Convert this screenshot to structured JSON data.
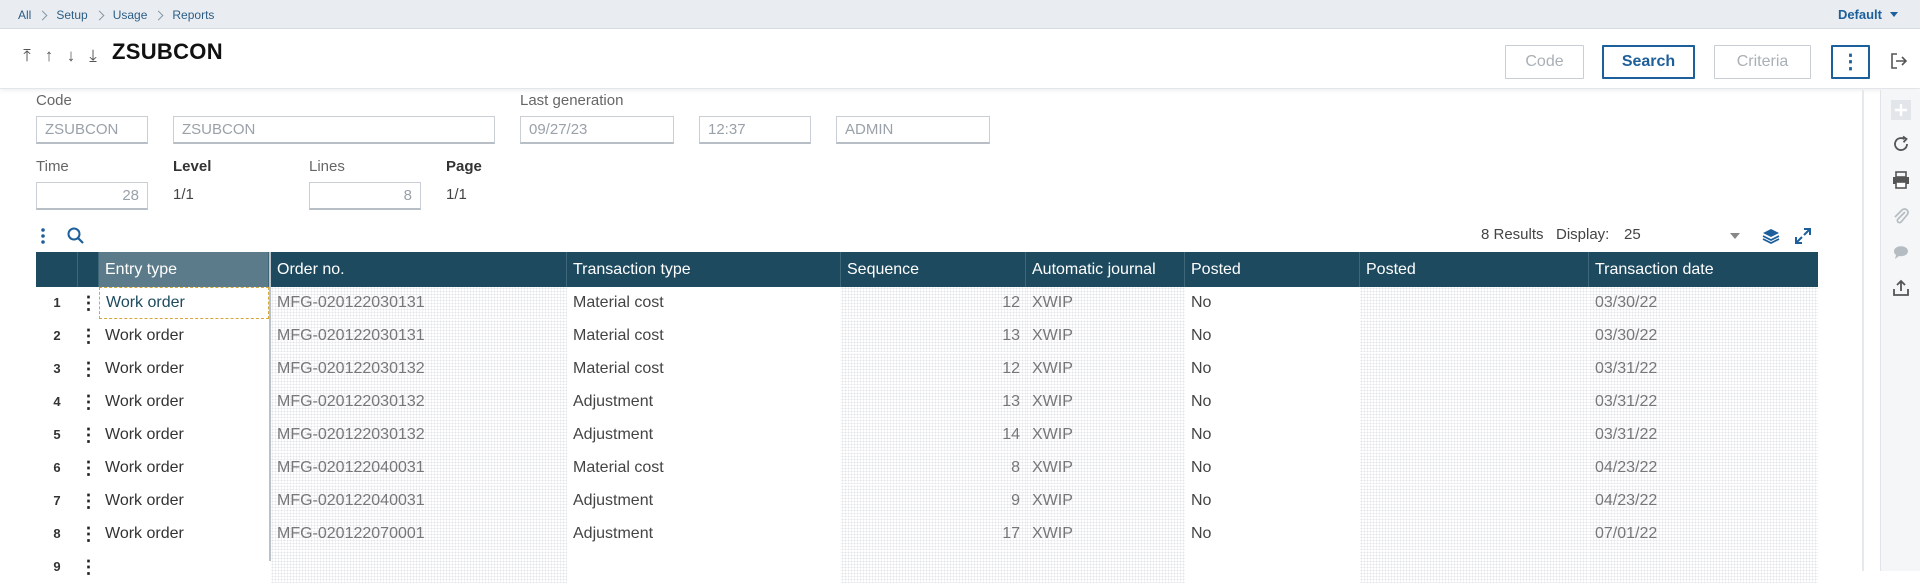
{
  "breadcrumb": [
    "All",
    "Setup",
    "Usage",
    "Reports"
  ],
  "default_menu": "Default",
  "header": {
    "title": "ZSUBCON",
    "nav_icons": [
      "first-record-icon",
      "previous-record-icon",
      "next-record-icon",
      "last-record-icon"
    ],
    "buttons": {
      "code": "Code",
      "search": "Search",
      "criteria": "Criteria",
      "more": "⋮"
    }
  },
  "form": {
    "code_label": "Code",
    "code_value": "ZSUBCON",
    "description_value": "ZSUBCON",
    "last_generation_label": "Last generation",
    "last_generation_date": "09/27/23",
    "last_generation_time": "12:37",
    "last_generation_user": "ADMIN",
    "time_label": "Time",
    "time_value": "28",
    "level_label": "Level",
    "level_value": "1/1",
    "lines_label": "Lines",
    "lines_value": "8",
    "page_label": "Page",
    "page_value": "1/1"
  },
  "grid": {
    "results_text": "8 Results",
    "display_label": "Display:",
    "display_value": "25",
    "columns": [
      "Entry type",
      "Order no.",
      "Transaction type",
      "Sequence",
      "Automatic journal",
      "Posted",
      "Posted",
      "Transaction date"
    ],
    "rows": [
      {
        "num": "1",
        "entry": "Work order",
        "order": "MFG-020122030131",
        "ttype": "Material cost",
        "seq": "12",
        "journal": "XWIP",
        "posted": "No",
        "posted2": "",
        "date": "03/30/22"
      },
      {
        "num": "2",
        "entry": "Work order",
        "order": "MFG-020122030131",
        "ttype": "Material cost",
        "seq": "13",
        "journal": "XWIP",
        "posted": "No",
        "posted2": "",
        "date": "03/30/22"
      },
      {
        "num": "3",
        "entry": "Work order",
        "order": "MFG-020122030132",
        "ttype": "Material cost",
        "seq": "12",
        "journal": "XWIP",
        "posted": "No",
        "posted2": "",
        "date": "03/31/22"
      },
      {
        "num": "4",
        "entry": "Work order",
        "order": "MFG-020122030132",
        "ttype": "Adjustment",
        "seq": "13",
        "journal": "XWIP",
        "posted": "No",
        "posted2": "",
        "date": "03/31/22"
      },
      {
        "num": "5",
        "entry": "Work order",
        "order": "MFG-020122030132",
        "ttype": "Adjustment",
        "seq": "14",
        "journal": "XWIP",
        "posted": "No",
        "posted2": "",
        "date": "03/31/22"
      },
      {
        "num": "6",
        "entry": "Work order",
        "order": "MFG-020122040031",
        "ttype": "Material cost",
        "seq": "8",
        "journal": "XWIP",
        "posted": "No",
        "posted2": "",
        "date": "04/23/22"
      },
      {
        "num": "7",
        "entry": "Work order",
        "order": "MFG-020122040031",
        "ttype": "Adjustment",
        "seq": "9",
        "journal": "XWIP",
        "posted": "No",
        "posted2": "",
        "date": "04/23/22"
      },
      {
        "num": "8",
        "entry": "Work order",
        "order": "MFG-020122070001",
        "ttype": "Adjustment",
        "seq": "17",
        "journal": "XWIP",
        "posted": "No",
        "posted2": "",
        "date": "07/01/22"
      },
      {
        "num": "9",
        "entry": "",
        "order": "",
        "ttype": "",
        "seq": "",
        "journal": "",
        "posted": "",
        "posted2": "",
        "date": ""
      }
    ]
  },
  "colors": {
    "header_bg": "#1d4a5f",
    "accent": "#1d5f9a",
    "topbar_bg": "#e9edf1"
  }
}
